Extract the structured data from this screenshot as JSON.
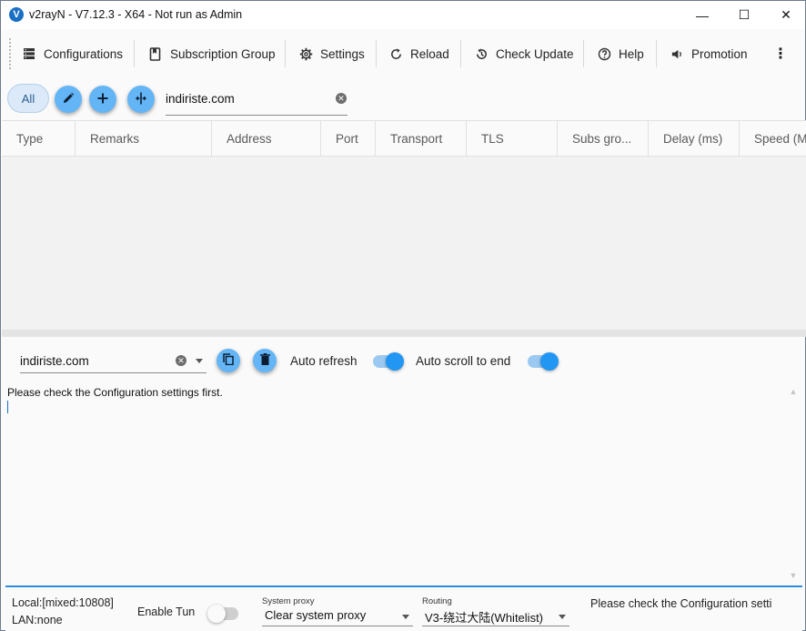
{
  "window": {
    "title": "v2rayN - V7.12.3 - X64 - Not run as Admin",
    "logo_glyph": "V",
    "minimize_glyph": "—",
    "maximize_glyph": "☐",
    "close_glyph": "✕"
  },
  "toolbar": {
    "configurations": "Configurations",
    "subscription_group": "Subscription Group",
    "settings": "Settings",
    "reload": "Reload",
    "check_update": "Check Update",
    "help": "Help",
    "promotion": "Promotion",
    "more_glyph": "⋮"
  },
  "filter": {
    "all_label": "All",
    "search_value": "indiriste.com"
  },
  "table": {
    "columns": [
      "Type",
      "Remarks",
      "Address",
      "Port",
      "Transport",
      "TLS",
      "Subs gro...",
      "Delay (ms)",
      "Speed (M"
    ]
  },
  "log": {
    "filter_value": "indiriste.com",
    "auto_refresh_label": "Auto refresh",
    "auto_refresh_on": true,
    "auto_scroll_label": "Auto scroll to end",
    "auto_scroll_on": true,
    "message": "Please check the Configuration settings first."
  },
  "status": {
    "local": "Local:[mixed:10808]",
    "lan": "LAN:none",
    "enable_tun_label": "Enable Tun",
    "enable_tun_on": false,
    "system_proxy_caption": "System proxy",
    "system_proxy_value": "Clear system proxy",
    "routing_caption": "Routing",
    "routing_value": "V3-绕过大陆(Whitelist)",
    "message": "Please check the Configuration setti"
  },
  "colors": {
    "accent": "#2196f3",
    "fab": "#64b5f6",
    "status_border": "#2b8ce0"
  }
}
